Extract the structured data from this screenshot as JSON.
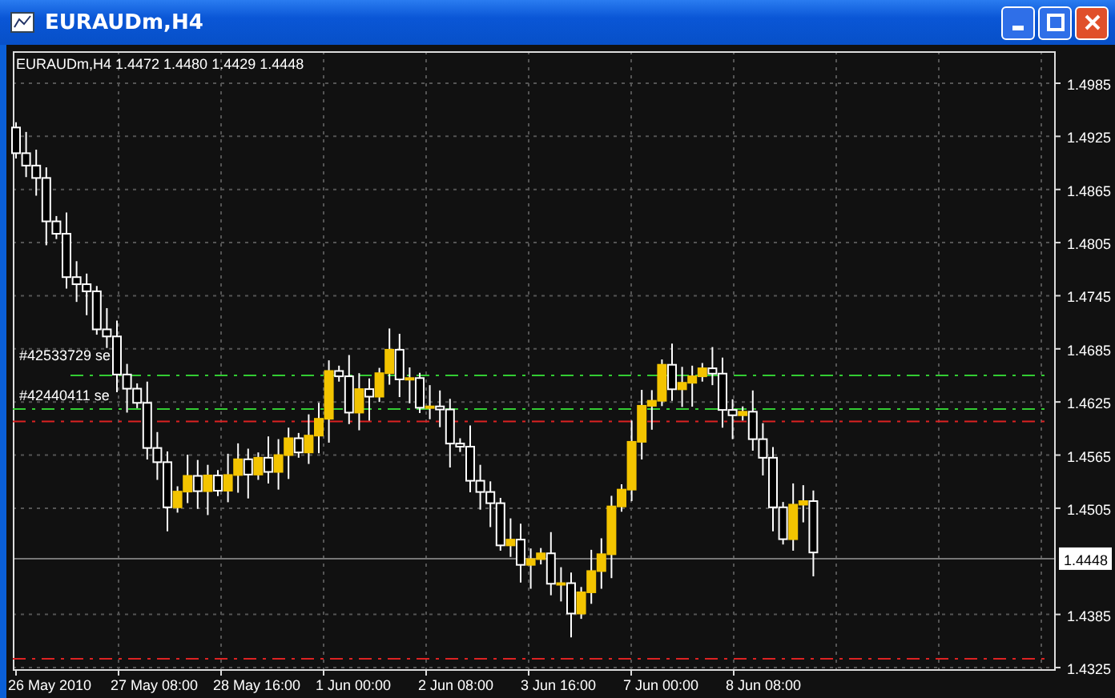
{
  "window": {
    "title": "EURAUDm,H4"
  },
  "chart": {
    "header": "EURAUDm,H4  1.4472 1.4480 1.4429 1.4448",
    "price_labels": [
      "1.4985",
      "1.4925",
      "1.4865",
      "1.4805",
      "1.4745",
      "1.4685",
      "1.4625",
      "1.4565",
      "1.4505",
      "1.4385",
      "1.4325"
    ],
    "current_price": "1.4448",
    "time_labels": [
      "26 May 2010",
      "27 May 08:00",
      "28 May 16:00",
      "1 Jun 00:00",
      "2 Jun 08:00",
      "3 Jun 16:00",
      "7 Jun 00:00",
      "8 Jun 08:00"
    ],
    "order_lines": [
      {
        "label": "#42533729 se"
      },
      {
        "label": "#42440411 se"
      }
    ]
  }
}
